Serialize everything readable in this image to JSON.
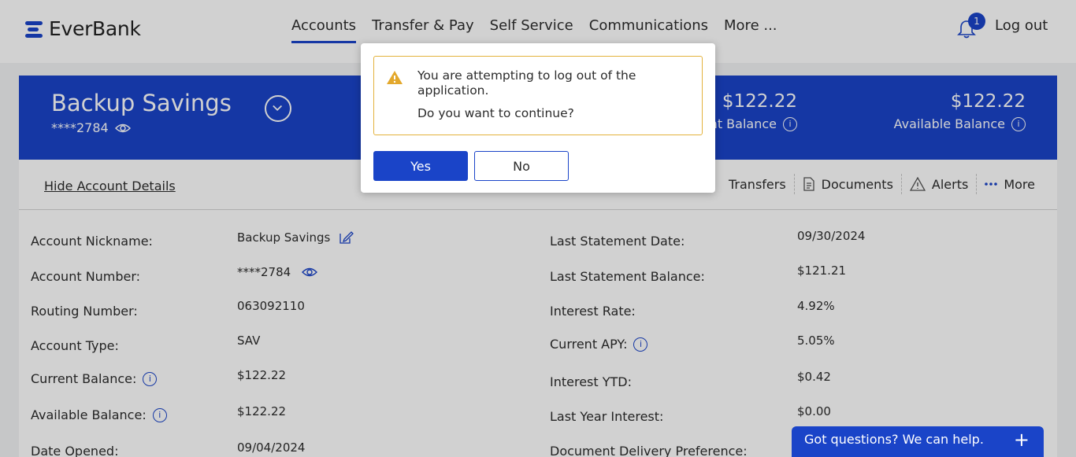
{
  "header": {
    "logo_text": "EverBank",
    "nav": [
      "Accounts",
      "Transfer & Pay",
      "Self Service",
      "Communications",
      "More ..."
    ],
    "notification_count": "1",
    "logout_label": "Log out"
  },
  "account": {
    "name": "Backup Savings",
    "masked_number": "****2784",
    "current_balance_amount": "$122.22",
    "current_balance_label": "rent Balance",
    "available_balance_amount": "$122.22",
    "available_balance_label": "Available Balance"
  },
  "strip": {
    "hide_link": "Hide Account Details",
    "actions": [
      "Transfers",
      "Documents",
      "Alerts",
      "More"
    ]
  },
  "details": {
    "left": [
      {
        "label": "Account Nickname:",
        "value": "Backup Savings"
      },
      {
        "label": "Account Number:",
        "value": "****2784"
      },
      {
        "label": "Routing Number:",
        "value": "063092110"
      },
      {
        "label": "Account Type:",
        "value": "SAV"
      },
      {
        "label": "Current Balance:",
        "value": "$122.22"
      },
      {
        "label": "Available Balance:",
        "value": "$122.22"
      },
      {
        "label": "Date Opened:",
        "value": "09/04/2024"
      }
    ],
    "right": [
      {
        "label": "Last Statement Date:",
        "value": "09/30/2024"
      },
      {
        "label": "Last Statement Balance:",
        "value": "$121.21"
      },
      {
        "label": "Interest Rate:",
        "value": "4.92%"
      },
      {
        "label": "Current APY:",
        "value": "5.05%"
      },
      {
        "label": "Interest YTD:",
        "value": "$0.42"
      },
      {
        "label": "Last Year Interest:",
        "value": "$0.00"
      },
      {
        "label": "Document Delivery Preference:",
        "value": ""
      }
    ]
  },
  "modal": {
    "message": "You are attempting to log out of the application.",
    "question": "Do you want to continue?",
    "yes_label": "Yes",
    "no_label": "No"
  },
  "chat": {
    "label": "Got questions? We can help.",
    "plus": "+"
  },
  "colors": {
    "brand_blue": "#1a44c8",
    "warning": "#e3b23c"
  }
}
